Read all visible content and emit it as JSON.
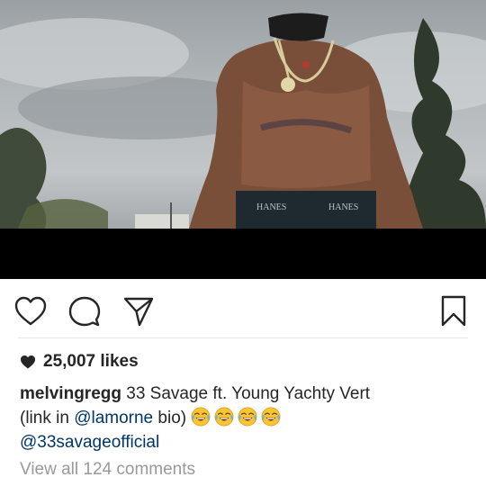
{
  "post": {
    "media_alt_icon": "video-frame",
    "waistband_text_left": "HANES",
    "waistband_text_right": "HANES"
  },
  "actions": {
    "like": "heart-icon",
    "comment": "comment-icon",
    "share": "share-icon",
    "save": "bookmark-icon"
  },
  "likes": {
    "count_label": "25,007 likes",
    "icon": "heart-filled-icon"
  },
  "caption": {
    "username": "melvingregg",
    "text_1": "33 Savage ft. Young Yachty Vert",
    "text_2_prefix": "(link in ",
    "mention_1": "@lamorne",
    "text_2_suffix": " bio)",
    "emoji": [
      "tears-of-joy",
      "tears-of-joy",
      "tears-of-joy",
      "tears-of-joy"
    ],
    "mention_2": "@33savageofficial"
  },
  "comments": {
    "view_all_label": "View all 124 comments"
  },
  "colors": {
    "text": "#262626",
    "mention": "#003569",
    "muted": "#999999",
    "letterbox": "#000000"
  }
}
